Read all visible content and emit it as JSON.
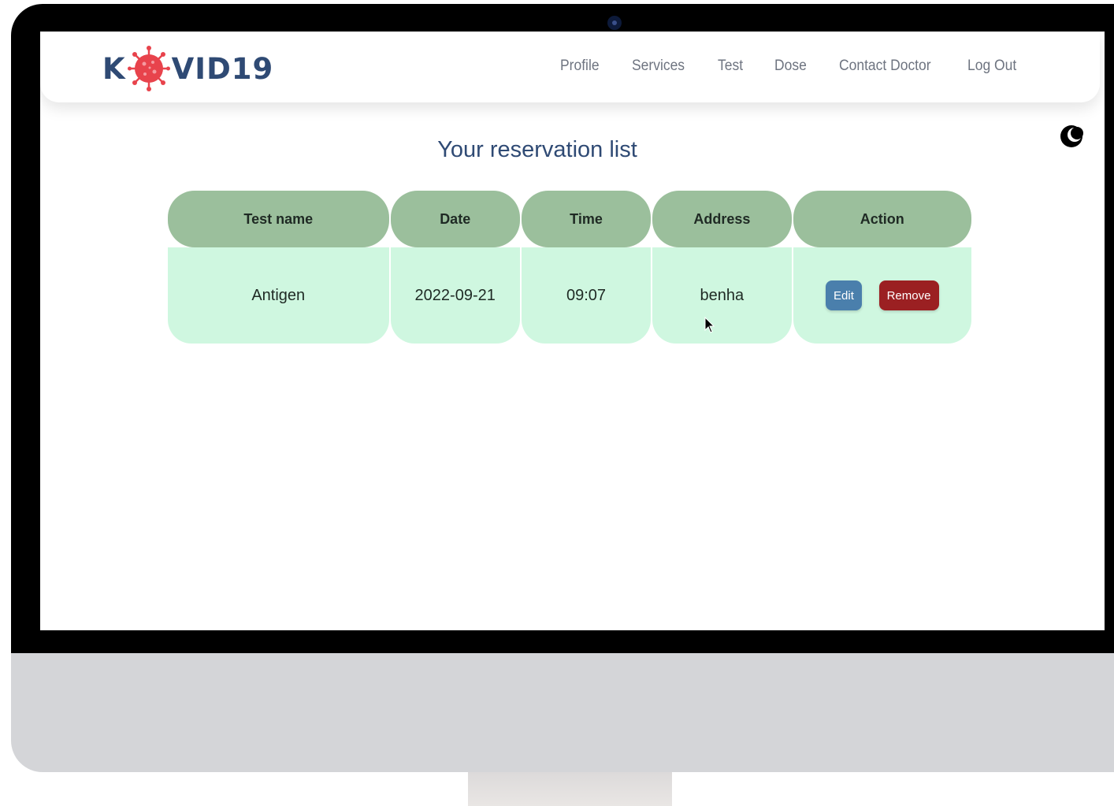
{
  "logo": {
    "prefix": "K",
    "suffix": "VID19",
    "icon": "virus-icon",
    "accent_color": "#e8434c"
  },
  "nav": {
    "items": [
      {
        "label": "Profile"
      },
      {
        "label": "Services"
      },
      {
        "label": "Test"
      },
      {
        "label": "Dose"
      },
      {
        "label": "Contact Doctor"
      },
      {
        "label": "Log Out"
      }
    ]
  },
  "theme_toggle": {
    "icon": "moon-icon"
  },
  "page": {
    "title": "Your reservation list"
  },
  "table": {
    "headers": [
      "Test name",
      "Date",
      "Time",
      "Address",
      "Action"
    ],
    "rows": [
      {
        "test_name": "Antigen",
        "date": "2022-09-21",
        "time": "09:07",
        "address": "benha",
        "edit_label": "Edit",
        "remove_label": "Remove"
      }
    ],
    "header_color": "#9bbf9c",
    "row_color": "#cff7e0"
  },
  "colors": {
    "edit": "#4a7fac",
    "remove": "#9b2022",
    "title": "#2f4a74"
  }
}
